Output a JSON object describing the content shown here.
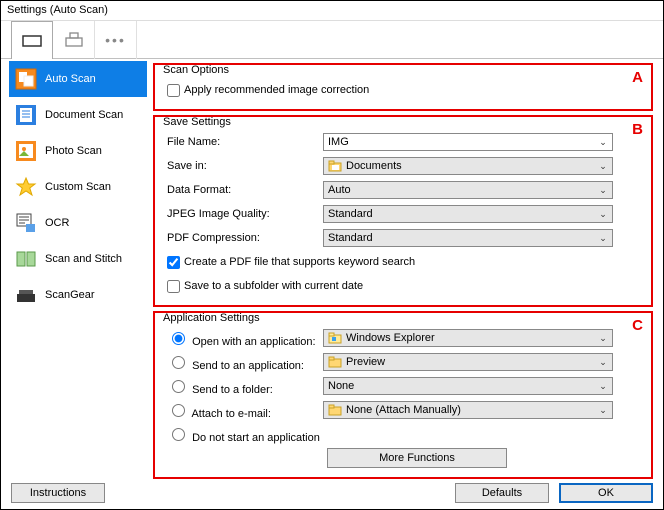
{
  "window": {
    "title": "Settings (Auto Scan)"
  },
  "toolbar": {
    "tab_scanner": "scanner",
    "tab_printer": "printer",
    "tab_more": "more"
  },
  "sidebar": {
    "items": [
      {
        "label": "Auto Scan",
        "icon": "auto-scan",
        "active": true
      },
      {
        "label": "Document Scan",
        "icon": "document-scan"
      },
      {
        "label": "Photo Scan",
        "icon": "photo-scan"
      },
      {
        "label": "Custom Scan",
        "icon": "custom-scan"
      },
      {
        "label": "OCR",
        "icon": "ocr"
      },
      {
        "label": "Scan and Stitch",
        "icon": "scan-stitch"
      },
      {
        "label": "ScanGear",
        "icon": "scangear"
      }
    ]
  },
  "scan_options": {
    "group_title": "Scan Options",
    "badge": "A",
    "apply_correction": {
      "label": "Apply recommended image correction",
      "checked": false
    }
  },
  "save_settings": {
    "group_title": "Save Settings",
    "badge": "B",
    "file_name": {
      "label": "File Name:",
      "value": "IMG"
    },
    "save_in": {
      "label": "Save in:",
      "value": "Documents",
      "icon": "folder-docs"
    },
    "data_format": {
      "label": "Data Format:",
      "value": "Auto"
    },
    "jpeg_quality": {
      "label": "JPEG Image Quality:",
      "value": "Standard"
    },
    "pdf_compression": {
      "label": "PDF Compression:",
      "value": "Standard"
    },
    "pdf_keyword": {
      "label": "Create a PDF file that supports keyword search",
      "checked": true
    },
    "subfolder_date": {
      "label": "Save to a subfolder with current date",
      "checked": false
    }
  },
  "app_settings": {
    "group_title": "Application Settings",
    "badge": "C",
    "open_with": {
      "label": "Open with an application:",
      "value": "Windows Explorer",
      "icon": "explorer",
      "selected": true
    },
    "send_app": {
      "label": "Send to an application:",
      "value": "Preview",
      "icon": "folder"
    },
    "send_folder": {
      "label": "Send to a folder:",
      "value": "None"
    },
    "attach_email": {
      "label": "Attach to e-mail:",
      "value": "None (Attach Manually)",
      "icon": "folder"
    },
    "do_not_start": {
      "label": "Do not start an application"
    },
    "more_functions": "More Functions"
  },
  "footer": {
    "instructions": "Instructions",
    "defaults": "Defaults",
    "ok": "OK"
  }
}
